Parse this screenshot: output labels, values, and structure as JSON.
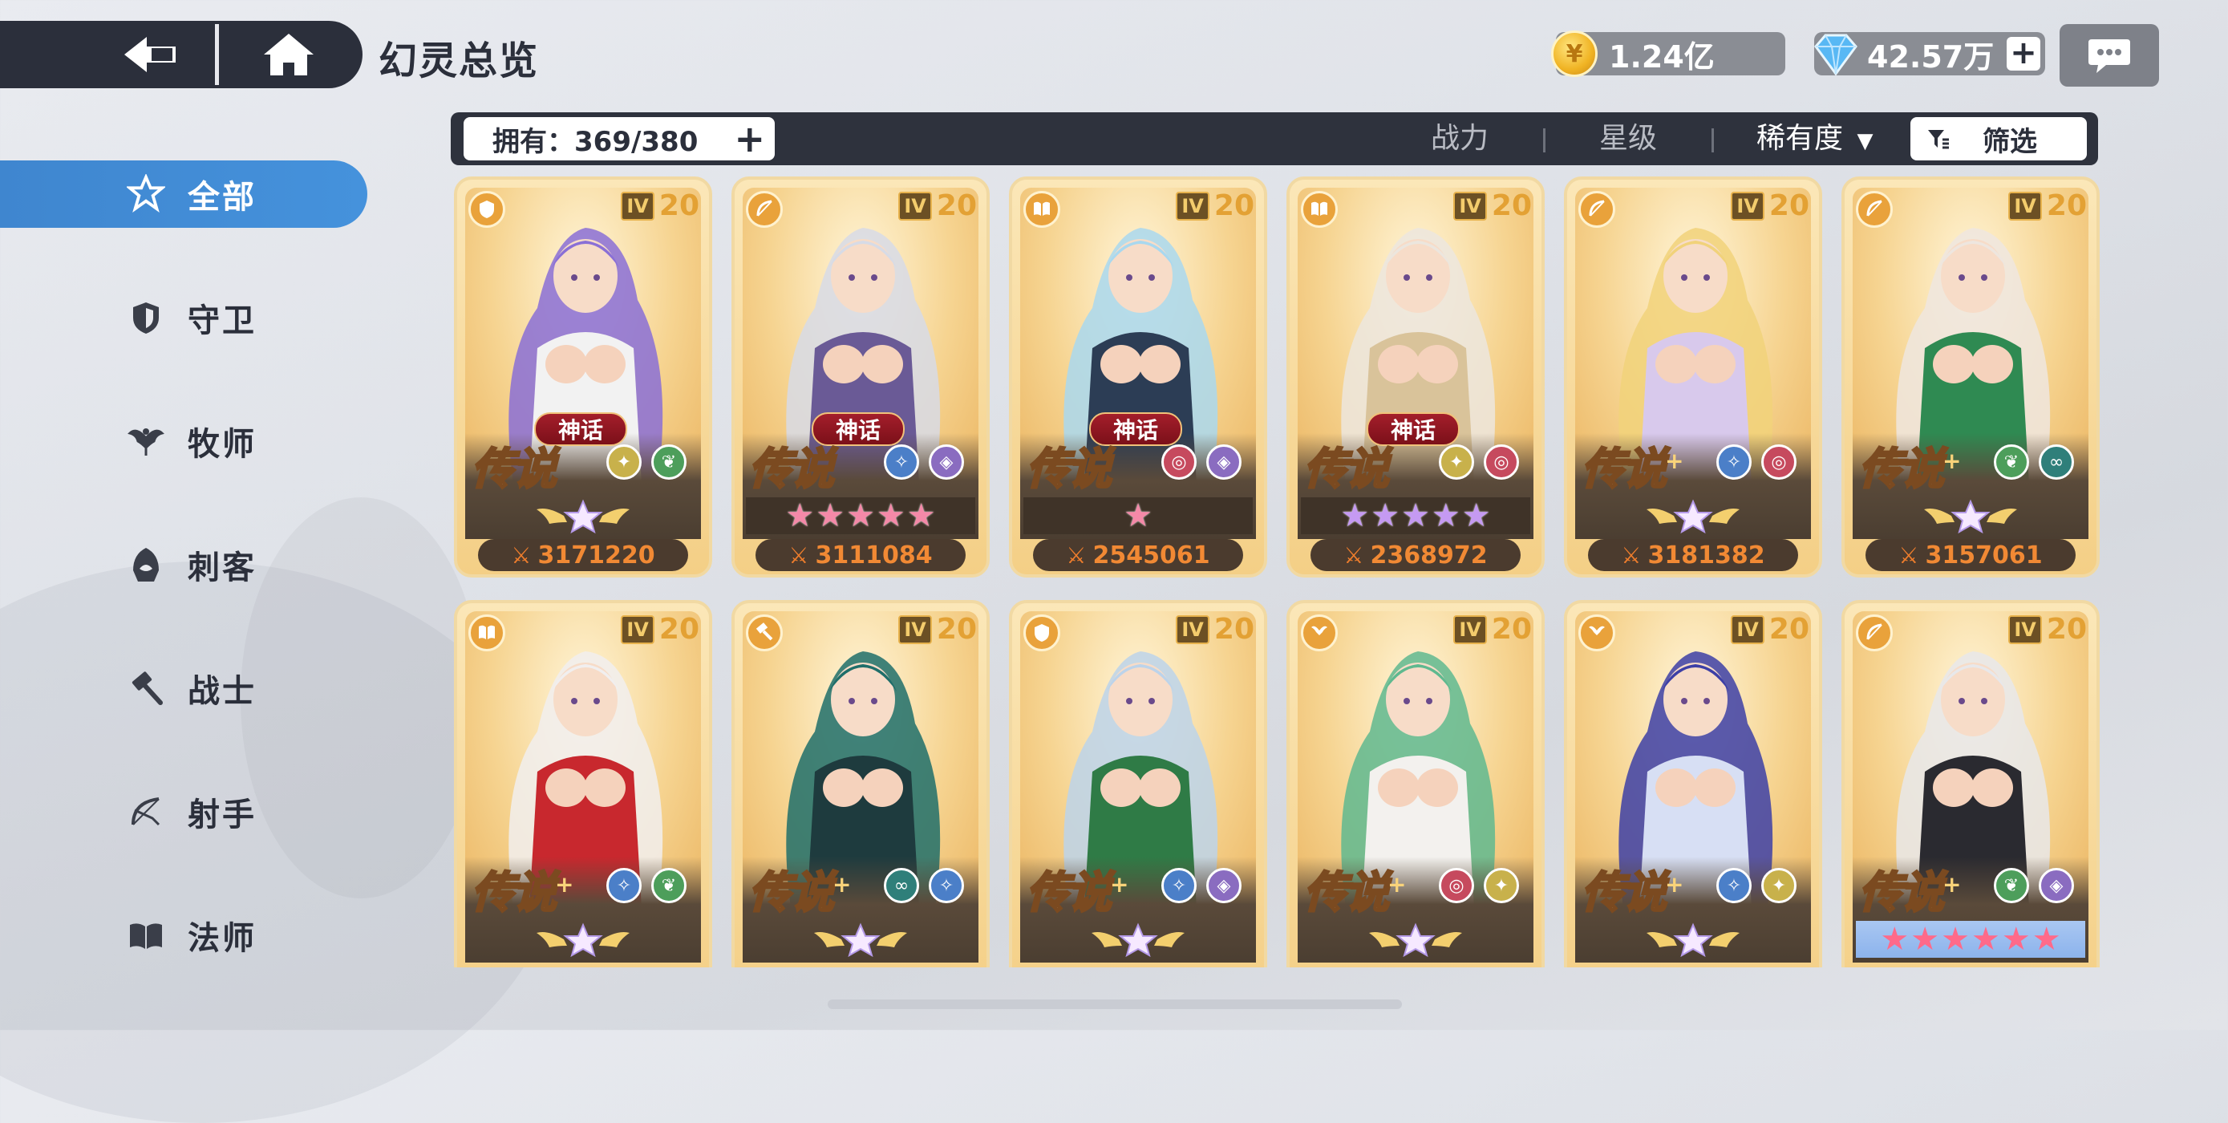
{
  "header": {
    "title": "幻灵总览",
    "gold": "1.24亿",
    "gems": "42.57万",
    "plus": "+"
  },
  "sidebar": {
    "items": [
      {
        "label": "全部",
        "icon": "all-star-icon",
        "active": true
      },
      {
        "label": "守卫",
        "icon": "shield-icon"
      },
      {
        "label": "牧师",
        "icon": "priest-wing-icon"
      },
      {
        "label": "刺客",
        "icon": "assassin-hood-icon"
      },
      {
        "label": "战士",
        "icon": "hammer-icon"
      },
      {
        "label": "射手",
        "icon": "bow-icon"
      },
      {
        "label": "法师",
        "icon": "book-icon"
      }
    ]
  },
  "filterbar": {
    "owned": "拥有：369/380",
    "sort_power": "战力",
    "sort_star": "星级",
    "sort_rarity": "稀有度",
    "filter": "筛选"
  },
  "cards": [
    {
      "level": "20",
      "iv": "IV",
      "tag": "神话",
      "rarity": "传说",
      "plus": "",
      "power": "3171220",
      "class_icon": "shield-icon",
      "stars": "emblem",
      "elements": [
        "nature-wing",
        "leaf"
      ],
      "hair": "#8a6fd6",
      "outfit": "#f2f2f2"
    },
    {
      "level": "20",
      "iv": "IV",
      "tag": "神话",
      "rarity": "传说",
      "plus": "",
      "power": "3111084",
      "class_icon": "bow-icon",
      "stars": "pink5",
      "elements": [
        "star",
        "diamond"
      ],
      "hair": "#d7dbe6",
      "outfit": "#6a5a96"
    },
    {
      "level": "20",
      "iv": "IV",
      "tag": "神话",
      "rarity": "传说",
      "plus": "",
      "power": "2545061",
      "class_icon": "book-icon",
      "stars": "pink1",
      "elements": [
        "swirl",
        "diamond"
      ],
      "hair": "#a9d8ef",
      "outfit": "#2c3d55"
    },
    {
      "level": "20",
      "iv": "IV",
      "tag": "神话",
      "rarity": "传说",
      "plus": "",
      "power": "2368972",
      "class_icon": "book-icon",
      "stars": "purple5",
      "elements": [
        "nature-wing",
        "swirl"
      ],
      "hair": "#ece6de",
      "outfit": "#d9c39a"
    },
    {
      "level": "20",
      "iv": "IV",
      "tag": "",
      "rarity": "传说",
      "plus": "+",
      "power": "3181382",
      "class_icon": "bow-icon",
      "stars": "emblem",
      "elements": [
        "star",
        "swirl"
      ],
      "hair": "#f1d27a",
      "outfit": "#d8c9ec"
    },
    {
      "level": "20",
      "iv": "IV",
      "tag": "",
      "rarity": "传说",
      "plus": "+",
      "power": "3157061",
      "class_icon": "bow-icon",
      "stars": "emblem",
      "elements": [
        "leaf",
        "infinity"
      ],
      "hair": "#eee6df",
      "outfit": "#2f8a52"
    },
    {
      "level": "20",
      "iv": "IV",
      "tag": "",
      "rarity": "传说",
      "plus": "+",
      "power": "",
      "class_icon": "book-icon",
      "stars": "emblem",
      "elements": [
        "star",
        "leaf"
      ],
      "hair": "#f1efef",
      "outfit": "#c8282e"
    },
    {
      "level": "20",
      "iv": "IV",
      "tag": "",
      "rarity": "传说",
      "plus": "+",
      "power": "",
      "class_icon": "hammer-icon",
      "stars": "emblem",
      "elements": [
        "infinity",
        "star"
      ],
      "hair": "#1f6e6a",
      "outfit": "#1e3b3e"
    },
    {
      "level": "20",
      "iv": "IV",
      "tag": "",
      "rarity": "传说",
      "plus": "+",
      "power": "",
      "class_icon": "shield-icon",
      "stars": "emblem",
      "elements": [
        "star",
        "diamond"
      ],
      "hair": "#bcd3ea",
      "outfit": "#2f7b46"
    },
    {
      "level": "20",
      "iv": "IV",
      "tag": "",
      "rarity": "传说",
      "plus": "+",
      "power": "",
      "class_icon": "priest-wing-icon",
      "stars": "emblem",
      "elements": [
        "swirl",
        "nature-wing"
      ],
      "hair": "#5fb98f",
      "outfit": "#f3f1ee"
    },
    {
      "level": "20",
      "iv": "IV",
      "tag": "",
      "rarity": "传说",
      "plus": "+",
      "power": "",
      "class_icon": "priest-wing-icon",
      "stars": "emblem",
      "elements": [
        "star",
        "nature-wing"
      ],
      "hair": "#3d3fa6",
      "outfit": "#d7dff4"
    },
    {
      "level": "20",
      "iv": "IV",
      "tag": "",
      "rarity": "传说",
      "plus": "+",
      "power": "",
      "class_icon": "bow-icon",
      "stars": "pinkblue6",
      "elements": [
        "leaf",
        "diamond"
      ],
      "hair": "#e8e8ea",
      "outfit": "#2a2a30"
    }
  ],
  "colors": {
    "accent": "#4592dc",
    "topbar": "#2b2f3b",
    "power_text": "#f18934"
  }
}
